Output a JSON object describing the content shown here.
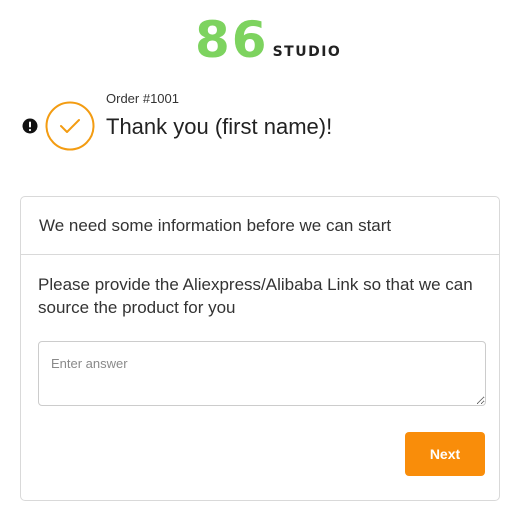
{
  "brand": {
    "number": "86",
    "word": "STUDIO",
    "color": "#7dd35f"
  },
  "order": {
    "number_label": "Order #1001",
    "thank_you": "Thank you (first name)!",
    "status_icon": "check-circle-icon",
    "alert_icon": "alert-icon",
    "accent_color": "#f39c12"
  },
  "form": {
    "header": "We need some information before we can start",
    "question": "Please provide the Aliexpress/Alibaba Link so that we can source the product for you",
    "answer_placeholder": "Enter answer",
    "answer_value": "",
    "next_label": "Next",
    "next_color": "#f98d0a"
  }
}
